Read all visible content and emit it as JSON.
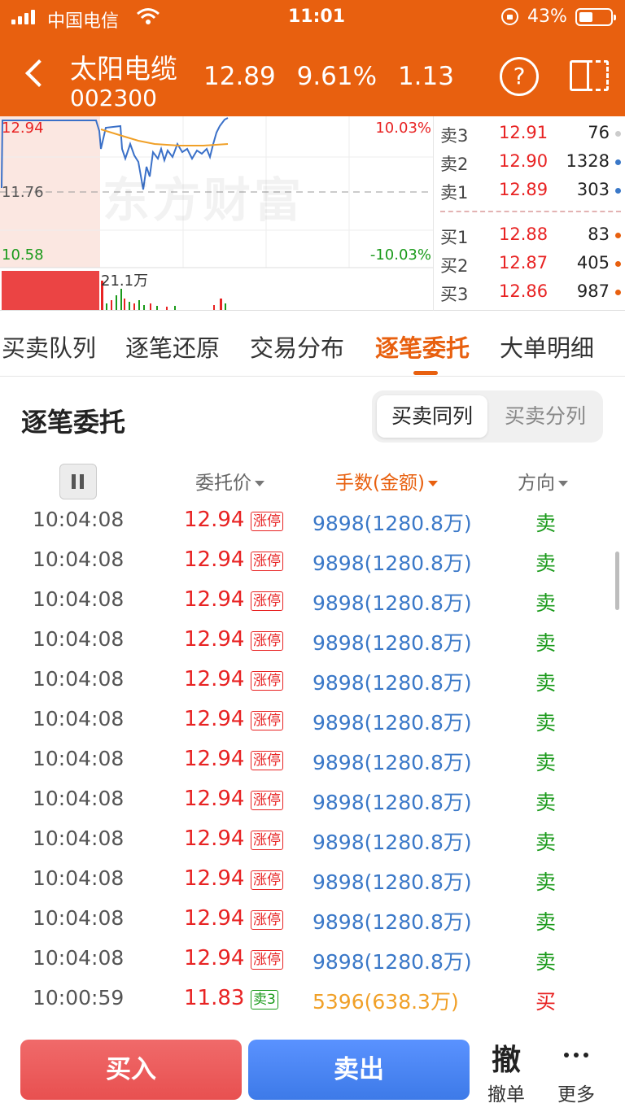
{
  "status_bar": {
    "carrier": "中国电信",
    "time": "11:01",
    "battery": "43%"
  },
  "header": {
    "stock_name": "太阳电缆",
    "stock_code": "002300",
    "price": "12.89",
    "change_pct": "9.61%",
    "change": "1.13",
    "help": "?"
  },
  "chart": {
    "high_price": "12.94",
    "ref_price": "11.76",
    "low_price": "10.58",
    "high_pct": "10.03%",
    "low_pct": "-10.03%",
    "volume_label": "21.1万",
    "watermark": "东方财富"
  },
  "orderbook": {
    "asks": [
      {
        "name": "卖3",
        "price": "12.91",
        "volume": "76",
        "dot": "#cccccc"
      },
      {
        "name": "卖2",
        "price": "12.90",
        "volume": "1328",
        "dot": "#3a78c8"
      },
      {
        "name": "卖1",
        "price": "12.89",
        "volume": "303",
        "dot": "#3a78c8"
      }
    ],
    "bids": [
      {
        "name": "买1",
        "price": "12.88",
        "volume": "83",
        "dot": "#e8600f"
      },
      {
        "name": "买2",
        "price": "12.87",
        "volume": "405",
        "dot": "#e8600f"
      },
      {
        "name": "买3",
        "price": "12.86",
        "volume": "987",
        "dot": "#e8600f"
      }
    ]
  },
  "tabs": [
    {
      "label": "买卖队列"
    },
    {
      "label": "逐笔还原"
    },
    {
      "label": "交易分布"
    },
    {
      "label": "逐笔委托"
    },
    {
      "label": "大单明细"
    }
  ],
  "active_tab": "逐笔委托",
  "section": {
    "title": "逐笔委托",
    "seg_on": "买卖同列",
    "seg_off": "买卖分列"
  },
  "columns": {
    "price": "委托价",
    "amount": "手数(金额)",
    "direction": "方向"
  },
  "rows": [
    {
      "time": "10:04:08",
      "price": "12.94",
      "tag": "涨停",
      "amount": "9898(1280.8万)",
      "dir": "卖",
      "price_color": "red",
      "tag_color": "red",
      "amount_color": "blue",
      "dir_color": "green"
    },
    {
      "time": "10:04:08",
      "price": "12.94",
      "tag": "涨停",
      "amount": "9898(1280.8万)",
      "dir": "卖",
      "price_color": "red",
      "tag_color": "red",
      "amount_color": "blue",
      "dir_color": "green"
    },
    {
      "time": "10:04:08",
      "price": "12.94",
      "tag": "涨停",
      "amount": "9898(1280.8万)",
      "dir": "卖",
      "price_color": "red",
      "tag_color": "red",
      "amount_color": "blue",
      "dir_color": "green"
    },
    {
      "time": "10:04:08",
      "price": "12.94",
      "tag": "涨停",
      "amount": "9898(1280.8万)",
      "dir": "卖",
      "price_color": "red",
      "tag_color": "red",
      "amount_color": "blue",
      "dir_color": "green"
    },
    {
      "time": "10:04:08",
      "price": "12.94",
      "tag": "涨停",
      "amount": "9898(1280.8万)",
      "dir": "卖",
      "price_color": "red",
      "tag_color": "red",
      "amount_color": "blue",
      "dir_color": "green"
    },
    {
      "time": "10:04:08",
      "price": "12.94",
      "tag": "涨停",
      "amount": "9898(1280.8万)",
      "dir": "卖",
      "price_color": "red",
      "tag_color": "red",
      "amount_color": "blue",
      "dir_color": "green"
    },
    {
      "time": "10:04:08",
      "price": "12.94",
      "tag": "涨停",
      "amount": "9898(1280.8万)",
      "dir": "卖",
      "price_color": "red",
      "tag_color": "red",
      "amount_color": "blue",
      "dir_color": "green"
    },
    {
      "time": "10:04:08",
      "price": "12.94",
      "tag": "涨停",
      "amount": "9898(1280.8万)",
      "dir": "卖",
      "price_color": "red",
      "tag_color": "red",
      "amount_color": "blue",
      "dir_color": "green"
    },
    {
      "time": "10:04:08",
      "price": "12.94",
      "tag": "涨停",
      "amount": "9898(1280.8万)",
      "dir": "卖",
      "price_color": "red",
      "tag_color": "red",
      "amount_color": "blue",
      "dir_color": "green"
    },
    {
      "time": "10:04:08",
      "price": "12.94",
      "tag": "涨停",
      "amount": "9898(1280.8万)",
      "dir": "卖",
      "price_color": "red",
      "tag_color": "red",
      "amount_color": "blue",
      "dir_color": "green"
    },
    {
      "time": "10:04:08",
      "price": "12.94",
      "tag": "涨停",
      "amount": "9898(1280.8万)",
      "dir": "卖",
      "price_color": "red",
      "tag_color": "red",
      "amount_color": "blue",
      "dir_color": "green"
    },
    {
      "time": "10:04:08",
      "price": "12.94",
      "tag": "涨停",
      "amount": "9898(1280.8万)",
      "dir": "卖",
      "price_color": "red",
      "tag_color": "red",
      "amount_color": "blue",
      "dir_color": "green"
    },
    {
      "time": "10:00:59",
      "price": "11.83",
      "tag": "卖3",
      "amount": "5396(638.3万)",
      "dir": "买",
      "price_color": "red",
      "tag_color": "green",
      "amount_color": "gold",
      "dir_color": "red"
    }
  ],
  "bottom": {
    "buy": "买入",
    "sell": "卖出",
    "cancel_icon": "撤",
    "cancel": "撤单",
    "more": "更多"
  },
  "colors": {
    "accent": "#e8600f",
    "up": "#e82323",
    "down": "#1a9a1a",
    "blue": "#3a78c8"
  }
}
